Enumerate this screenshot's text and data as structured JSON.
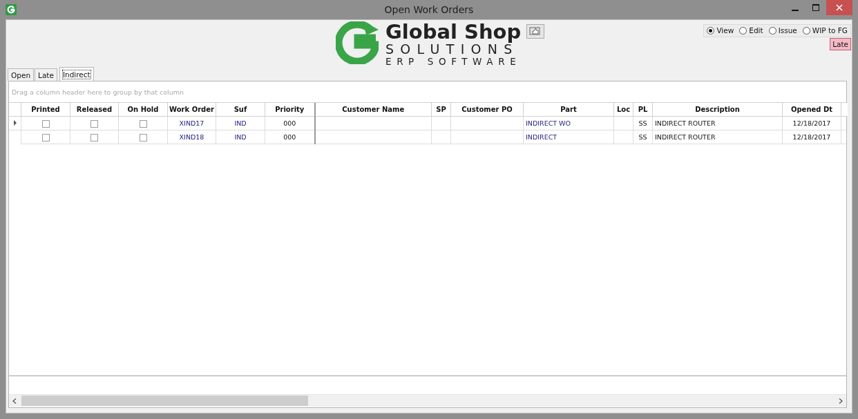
{
  "window": {
    "title": "Open Work Orders"
  },
  "logo": {
    "name": "Global Shop",
    "line_2": "SOLUTIONS",
    "line_3": "ERP SOFTWARE"
  },
  "modes": [
    {
      "label": "View",
      "selected": true
    },
    {
      "label": "Edit",
      "selected": false
    },
    {
      "label": "Issue",
      "selected": false
    },
    {
      "label": "WIP to FG",
      "selected": false
    }
  ],
  "late_badge": "Late",
  "tabs": [
    {
      "label": "Open",
      "selected": false
    },
    {
      "label": "Late",
      "selected": false
    },
    {
      "label": "Indirect",
      "selected": true
    }
  ],
  "group_hint": "Drag a column header here to group by that column",
  "table": {
    "columns": [
      "Printed",
      "Released",
      "On Hold",
      "Work Order",
      "Suf",
      "Priority",
      "Customer Name",
      "SP",
      "Customer PO",
      "Part",
      "Loc",
      "PL",
      "Description",
      "Opened Dt"
    ],
    "rows": [
      {
        "selected": true,
        "printed": false,
        "released": false,
        "on_hold": false,
        "work_order": "XIND17",
        "suf": "IND",
        "priority": "000",
        "part": "INDIRECT WO",
        "pl": "SS",
        "description": "INDIRECT ROUTER",
        "opened_dt": "12/18/2017"
      },
      {
        "selected": false,
        "printed": false,
        "released": false,
        "on_hold": false,
        "work_order": "XIND18",
        "suf": "IND",
        "priority": "000",
        "part": "INDIRECT",
        "pl": "SS",
        "description": "INDIRECT ROUTER",
        "opened_dt": "12/18/2017"
      }
    ]
  }
}
